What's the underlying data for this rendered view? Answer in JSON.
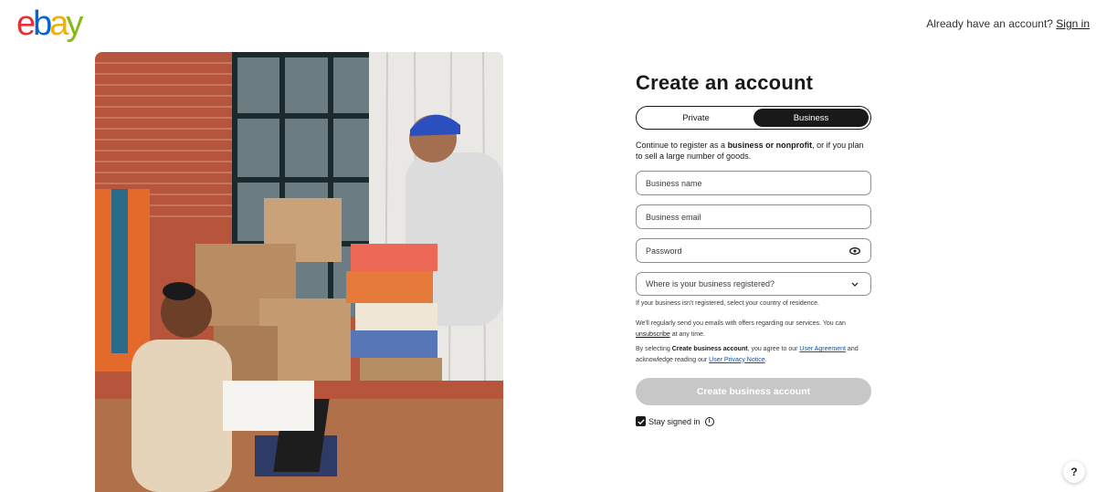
{
  "brand": {
    "logo_letters": [
      "e",
      "b",
      "a",
      "y"
    ],
    "colors": [
      "#e53238",
      "#0064d2",
      "#f5af02",
      "#86b817"
    ]
  },
  "header": {
    "prompt": "Already have an account?",
    "sign_in": "Sign in"
  },
  "form": {
    "title": "Create an account",
    "account_type": {
      "options": [
        "Private",
        "Business"
      ],
      "selected": "Business"
    },
    "intro": {
      "pre": "Continue to register as a ",
      "bold": "business or nonprofit",
      "post": ", or if you plan to sell a large number of goods."
    },
    "fields": {
      "business_name": "Business name",
      "business_email": "Business email",
      "password": "Password",
      "country": "Where is your business registered?"
    },
    "country_hint": "If your business isn't registered, select your country of residence.",
    "emails_notice": {
      "pre": "We'll regularly send you emails with offers regarding our services. You can ",
      "link": "unsubscribe",
      "post": " at any time."
    },
    "agreement": {
      "pre": "By selecting ",
      "bold": "Create business account",
      "mid": ", you agree to our ",
      "link1": "User Agreement",
      "mid2": " and acknowledge reading our ",
      "link2": "User Privacy Notice",
      "end": "."
    },
    "submit": "Create business account",
    "stay_signed_in": "Stay signed in"
  },
  "help": "?"
}
